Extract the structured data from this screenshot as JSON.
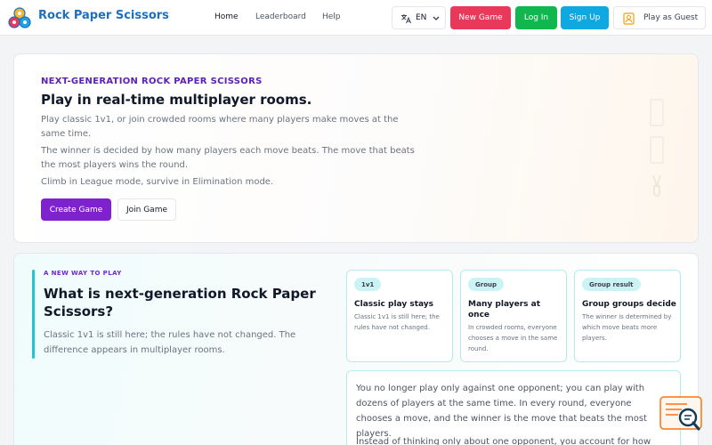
{
  "header": {
    "brand": "Rock Paper Scissors",
    "nav": [
      "Home",
      "Leaderboard",
      "Help"
    ],
    "language_code": "EN",
    "new_game": "New Game",
    "login": "Log In",
    "signup": "Sign Up",
    "guest": "Play as Guest"
  },
  "hero": {
    "eyebrow": "NEXT-GENERATION ROCK PAPER SCISSORS",
    "title": "Play in real-time multiplayer rooms.",
    "p1": "Play classic 1v1, or join crowded rooms where many players make moves at the same time.",
    "p2": "The winner is decided by how many players each move beats. The move that beats the most players wins the round.",
    "p3": "Climb in League mode, survive in Elimination mode.",
    "create_game": "Create Game",
    "join_game": "Join Game"
  },
  "info": {
    "eyebrow": "A NEW WAY TO PLAY",
    "title": "What is next-generation Rock Paper Scissors?",
    "paragraph": "Classic 1v1 is still here; the rules have not changed. The difference appears in multiplayer rooms.",
    "cards": [
      {
        "tag": "1v1",
        "title": "Classic play stays",
        "text": "Classic 1v1 is still here; the rules have not changed."
      },
      {
        "tag": "Group",
        "title": "Many players at once",
        "text": "In crowded rooms, everyone chooses a move in the same round."
      },
      {
        "tag": "Group result",
        "title": "Group groups decide",
        "text": "The winner is determined by which move beats more players."
      }
    ],
    "detail_p1": "You no longer play only against one opponent; you can play with dozens of players at the same time. In every round, everyone chooses a move, and the winner is the move that beats the most players.",
    "detail_p2": "Instead of thinking only about one opponent, you account for how"
  },
  "colors": {
    "brand": "#1f6fbf",
    "new_game": "#e8395a",
    "login": "#10b64e",
    "signup": "#10a8e0",
    "primary": "#7e22ce",
    "accent": "#22c3d3"
  },
  "icons": [
    "translate-icon",
    "chevron-down-icon",
    "guest-icon",
    "logo-icon",
    "chat-search-icon"
  ]
}
